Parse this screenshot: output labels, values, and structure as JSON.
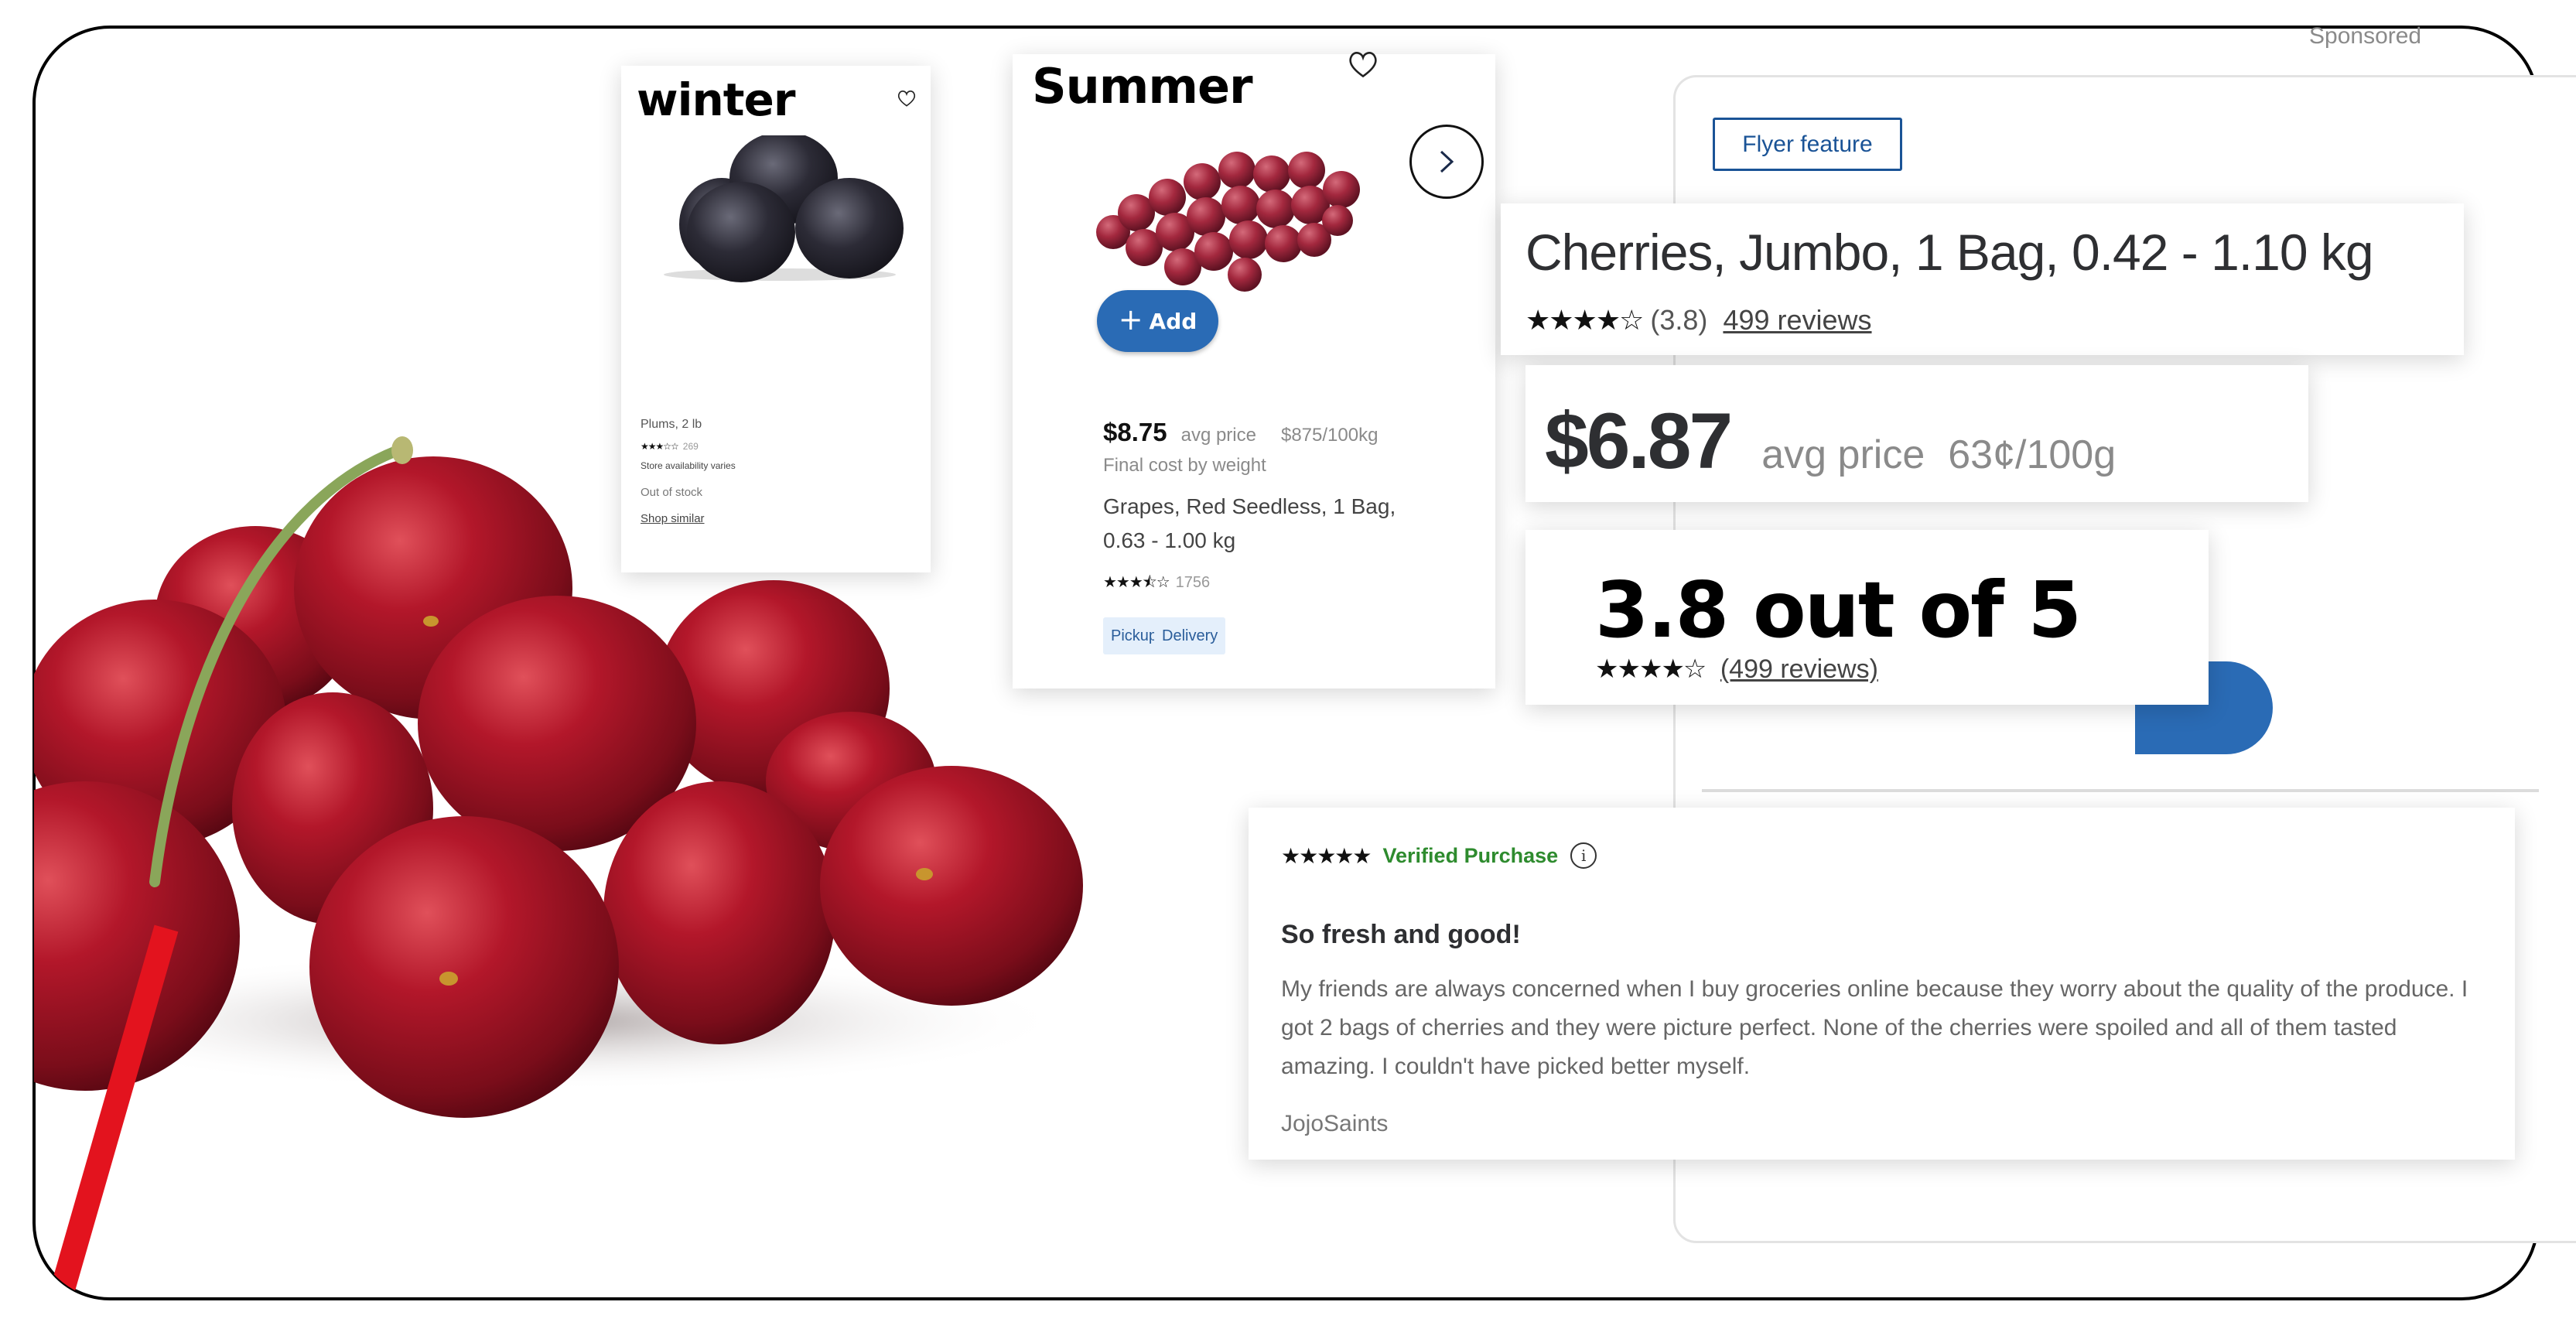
{
  "winter_card": {
    "season_label": "winter",
    "product_name": "Plums, 2 lb",
    "rating_stars": "★★★☆☆",
    "rating_value": 3,
    "review_count": "269",
    "availability": "Store availability varies",
    "stock_status": "Out of stock",
    "shop_similar_label": "Shop similar"
  },
  "summer_card": {
    "season_label": "Summer",
    "add_label": "Add",
    "price": "$8.75",
    "avg_price_label": "avg price",
    "unit_price": "$875/100kg",
    "final_cost_note": "Final cost by weight",
    "product_name": "Grapes, Red Seedless, 1 Bag, 0.63 - 1.00 kg",
    "rating_stars": "★★★⯪☆",
    "rating_value": 3.5,
    "review_count": "1756",
    "tags": [
      "Pickup",
      "Delivery"
    ]
  },
  "carousel": {
    "next_icon": "chevron-right-icon"
  },
  "product_panel": {
    "sponsored_label": "Sponsored",
    "flyer_tag": "Flyer feature",
    "title": "Cherries, Jumbo, 1 Bag, 0.42 - 1.10 kg",
    "rating_stars": "★★★★☆",
    "rating_value_text": "(3.8)",
    "reviews_link": "499 reviews",
    "price": "$6.87",
    "avg_price_label": "avg price",
    "unit_price": "63¢/100g",
    "rating_summary": "3.8 out of 5",
    "rating_summary_reviews": "(499 reviews)",
    "accent_color": "#2a6bb5"
  },
  "review": {
    "stars": "★★★★★",
    "rating_value": 5,
    "verified_label": "Verified Purchase",
    "title": "So fresh and good!",
    "body": "My friends are always concerned when I buy groceries online because they worry about the quality of the produce. I got 2 bags of cherries and they were picture perfect. None of the cherries were spoiled and all of them tasted amazing. I couldn't have picked better myself.",
    "author": "JojoSaints",
    "verified_color": "#2e8b2e"
  }
}
